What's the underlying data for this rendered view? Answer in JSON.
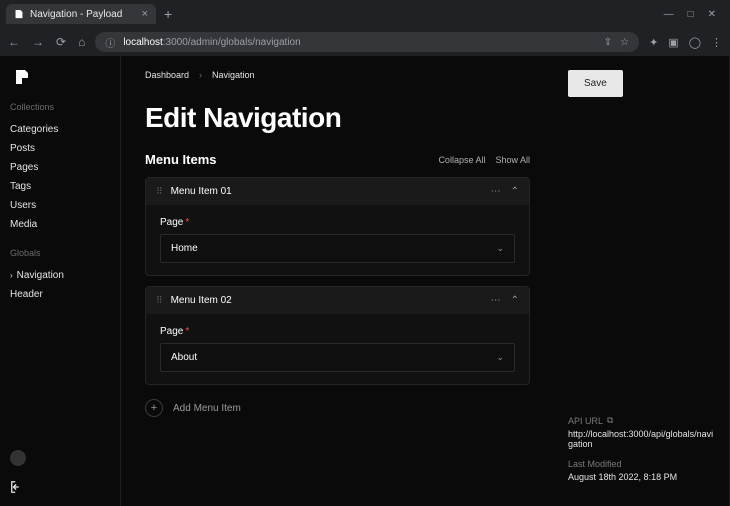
{
  "browser": {
    "tab_title": "Navigation - Payload",
    "addr_prefix": "localhost",
    "addr_path": ":3000/admin/globals/navigation"
  },
  "sidebar": {
    "groups": [
      {
        "title": "Collections",
        "items": [
          "Categories",
          "Posts",
          "Pages",
          "Tags",
          "Users",
          "Media"
        ]
      },
      {
        "title": "Globals",
        "items": [
          "Navigation",
          "Header"
        ],
        "active_index": 0
      }
    ]
  },
  "breadcrumb": [
    "Dashboard",
    "Navigation"
  ],
  "page_title": "Edit Navigation",
  "section": {
    "title": "Menu Items",
    "collapse_all": "Collapse All",
    "show_all": "Show All"
  },
  "items": [
    {
      "title": "Menu Item 01",
      "field_label": "Page",
      "value": "Home"
    },
    {
      "title": "Menu Item 02",
      "field_label": "Page",
      "value": "About"
    }
  ],
  "add_label": "Add Menu Item",
  "right": {
    "save": "Save",
    "api_url_label": "API URL",
    "api_url_value": "http://localhost:3000/api/globals/navigation",
    "last_modified_label": "Last Modified",
    "last_modified_value": "August 18th 2022, 8:18 PM"
  }
}
